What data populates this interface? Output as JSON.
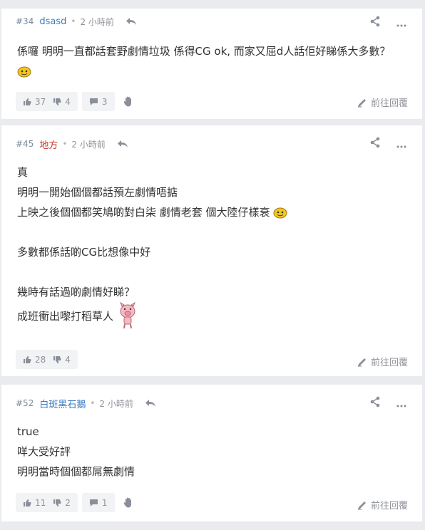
{
  "posts": [
    {
      "floor": "#34",
      "user": "dsasd",
      "user_color": "#3b7dbf",
      "time": "2 小時前",
      "lines": [
        "係囉 明明一直都話套野劇情垃圾 係得CG ok, 而家又屈d人話佢好睇係大多數？"
      ],
      "up": "37",
      "down": "4",
      "comments": "3",
      "reply_label": "前往回覆"
    },
    {
      "floor": "#45",
      "user": "地方",
      "user_color": "#c0392b",
      "time": "2 小時前",
      "lines": [
        "真",
        "明明一開始個個都話預左劇情唔掂",
        "上映之後個個都笑鳩啲對白柒 劇情老套 個大陸仔樣衰",
        "",
        "多數都係話啲CG比想像中好",
        "",
        "幾時有話過啲劇情好睇？",
        "成班衝出嚟打稻草人"
      ],
      "up": "28",
      "down": "4",
      "reply_label": "前往回覆"
    },
    {
      "floor": "#52",
      "user": "白斑黑石鵝",
      "user_color": "#3b7dbf",
      "time": "2 小時前",
      "lines": [
        "true",
        "咩大受好評",
        "明明當時個個都屌無劇情"
      ],
      "up": "11",
      "down": "2",
      "comments": "1",
      "reply_label": "前往回覆"
    }
  ],
  "icons": {
    "reply": "reply-arrow-icon",
    "share": "share-icon",
    "more": "more-dots-icon",
    "upvote": "thumb-up-icon",
    "downvote": "thumb-down-icon",
    "comment": "comment-icon",
    "hand": "hand-icon",
    "reply_link": "reply-pen-icon"
  }
}
